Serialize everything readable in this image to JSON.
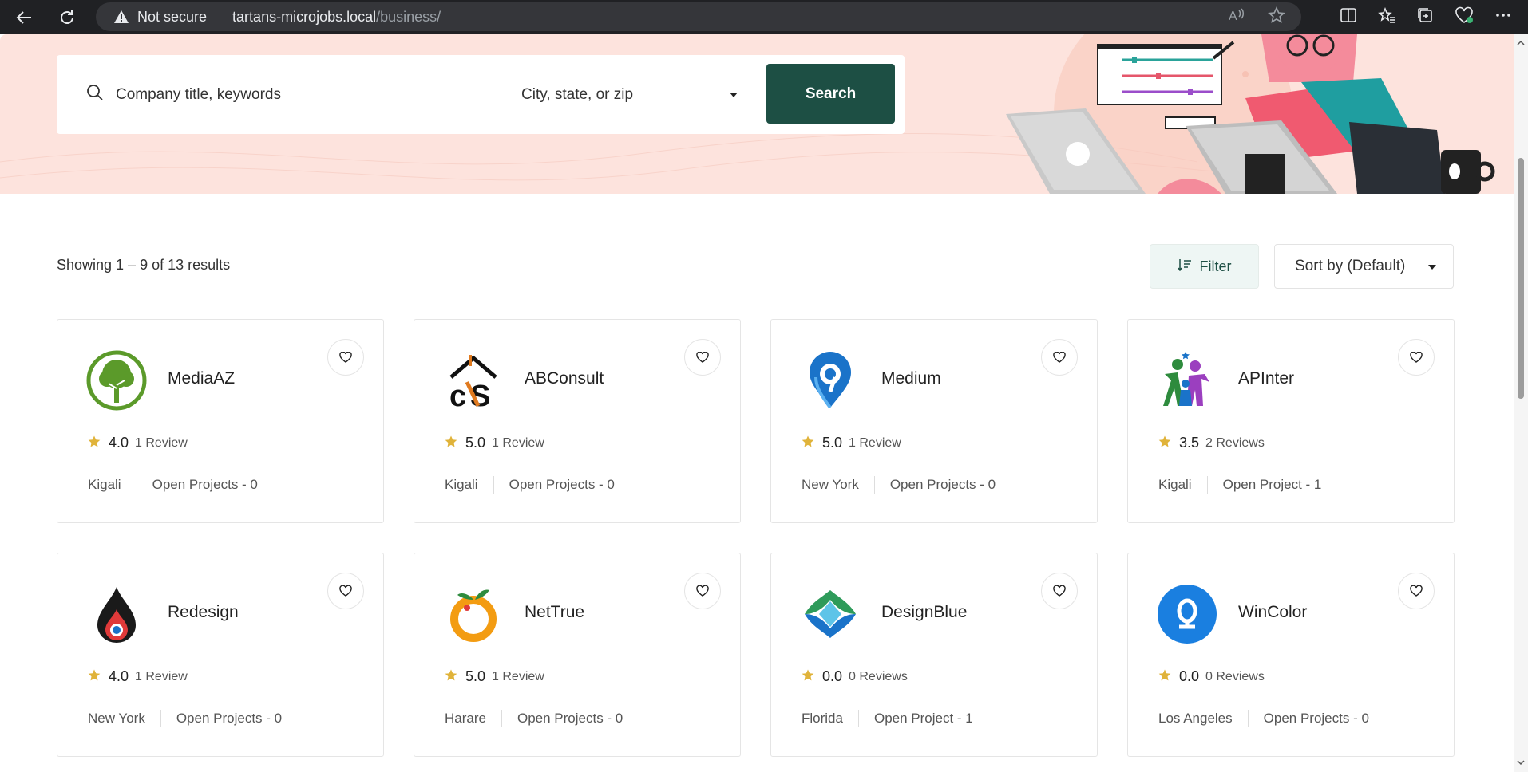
{
  "browser": {
    "security_label": "Not secure",
    "url_host": "tartans-microjobs.local",
    "url_path": "/business/"
  },
  "search": {
    "keyword_placeholder": "Company title, keywords",
    "location_placeholder": "City, state, or zip",
    "button_label": "Search"
  },
  "results": {
    "summary": "Showing 1 – 9 of 13 results",
    "filter_label": "Filter",
    "sort_label": "Sort by (Default)"
  },
  "companies": [
    {
      "name": "MediaAZ",
      "rating": "4.0",
      "reviews": "1 Review",
      "location": "Kigali",
      "projects": "Open Projects - 0",
      "logo": "tree-icon"
    },
    {
      "name": "ABConsult",
      "rating": "5.0",
      "reviews": "1 Review",
      "location": "Kigali",
      "projects": "Open Projects - 0",
      "logo": "house-monogram-icon"
    },
    {
      "name": "Medium",
      "rating": "5.0",
      "reviews": "1 Review",
      "location": "New York",
      "projects": "Open Projects - 0",
      "logo": "map-pin-icon"
    },
    {
      "name": "APInter",
      "rating": "3.5",
      "reviews": "2 Reviews",
      "location": "Kigali",
      "projects": "Open Project - 1",
      "logo": "people-icon"
    },
    {
      "name": "Redesign",
      "rating": "4.0",
      "reviews": "1 Review",
      "location": "New York",
      "projects": "Open Projects - 0",
      "logo": "flame-icon"
    },
    {
      "name": "NetTrue",
      "rating": "5.0",
      "reviews": "1 Review",
      "location": "Harare",
      "projects": "Open Projects - 0",
      "logo": "orange-fruit-icon"
    },
    {
      "name": "DesignBlue",
      "rating": "0.0",
      "reviews": "0 Reviews",
      "location": "Florida",
      "projects": "Open Project - 1",
      "logo": "diamond-leaf-icon"
    },
    {
      "name": "WinColor",
      "rating": "0.0",
      "reviews": "0 Reviews",
      "location": "Los Angeles",
      "projects": "Open Projects - 0",
      "logo": "blue-circle-letter-icon"
    }
  ],
  "colors": {
    "accent": "#1d4f44",
    "hero_bg": "#fde3dd",
    "star": "#e0b33a"
  }
}
